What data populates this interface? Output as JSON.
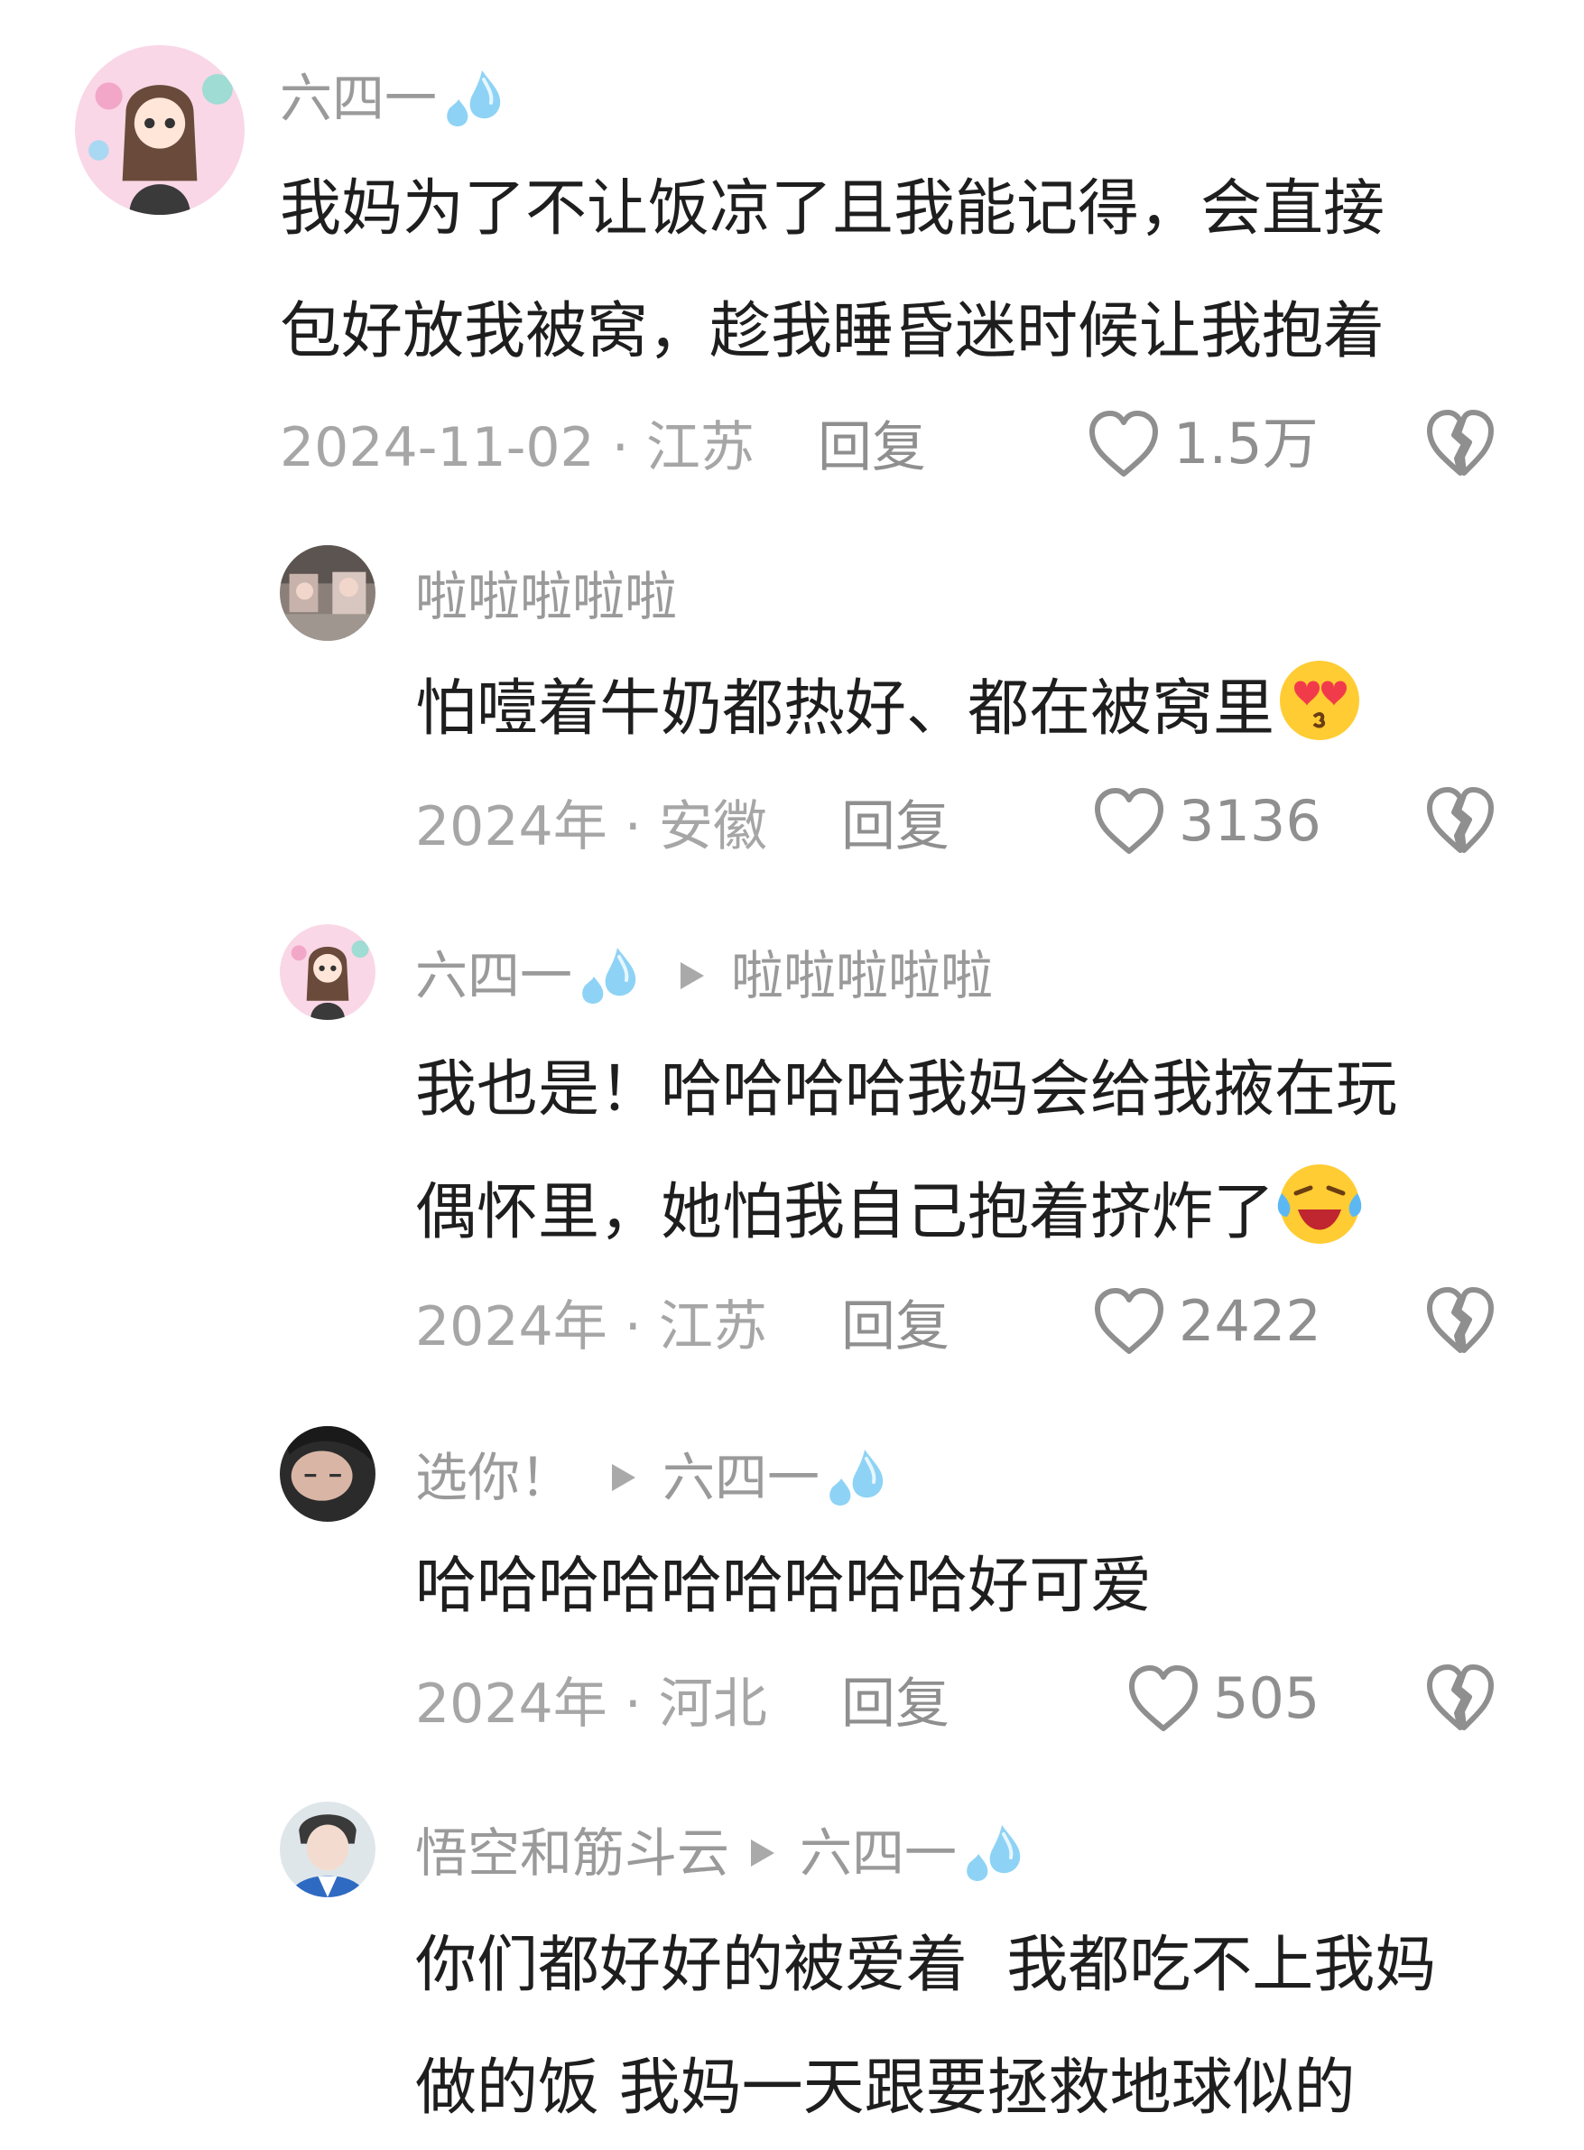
{
  "comments": [
    {
      "username": "六四一",
      "text_lines": [
        "我妈为了不让饭凉了且我能记得，会直接",
        "包好放我被窝，趁我睡昏迷时候让我抱着"
      ],
      "meta": "2024-11-02 · 江苏",
      "reply_label": "回复",
      "likes": "1.5万"
    },
    {
      "username": "啦啦啦啦啦",
      "text_lines": [
        "怕噎着牛奶都热好、都在被窝里"
      ],
      "emoji": "heart-eyes-emoji",
      "meta": "2024年 · 安徽",
      "reply_label": "回复",
      "likes": "3136"
    },
    {
      "username": "六四一",
      "reply_to": "啦啦啦啦啦",
      "text_lines": [
        "我也是！哈哈哈哈我妈会给我掖在玩",
        "偶怀里，她怕我自己抱着挤炸了"
      ],
      "emoji": "laughing-crying-emoji",
      "meta": "2024年 · 江苏",
      "reply_label": "回复",
      "likes": "2422"
    },
    {
      "username": "选你！",
      "reply_to": "六四一",
      "text_lines": [
        "哈哈哈哈哈哈哈哈哈好可爱"
      ],
      "meta": "2024年 · 河北",
      "reply_label": "回复",
      "likes": "505"
    },
    {
      "username": "悟空和筋斗云",
      "reply_to": "六四一",
      "text_lines": [
        "你们都好好的被爱着  我都吃不上我妈",
        "做的饭 我妈一天跟要拯救地球似的"
      ]
    }
  ],
  "icons": {
    "like": "heart-outline-icon",
    "dislike": "broken-heart-icon",
    "name_badge": "water-drops-icon",
    "reply_arrow": "play-arrow-icon"
  },
  "colors": {
    "text": "#1e1e1e",
    "username": "#9a9a9a",
    "meta": "#a6a6a6",
    "icon": "#8f8f8f"
  }
}
